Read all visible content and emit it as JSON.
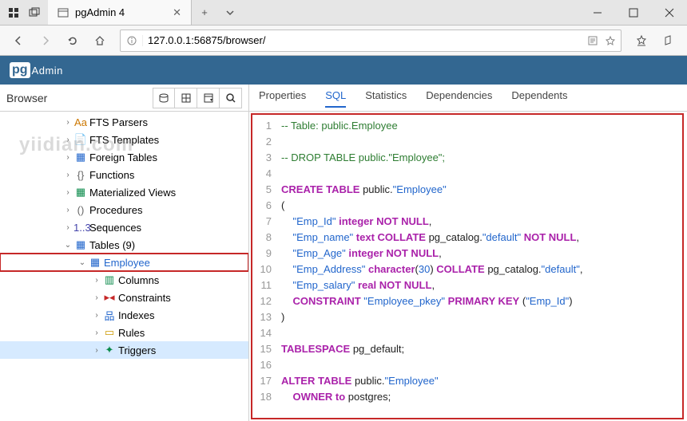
{
  "browser": {
    "tab_title": "pgAdmin 4",
    "url": "127.0.0.1:56875/browser/",
    "new_tab": "+"
  },
  "pg": {
    "logo_left": "pg",
    "logo_right": "Admin"
  },
  "sidebar": {
    "title": "Browser",
    "watermark": "yiidian.com",
    "items": [
      {
        "label": "FTS Parsers",
        "icon": "Aa",
        "arrow": ">",
        "lvl": 1,
        "color": "#cc7700"
      },
      {
        "label": "FTS Templates",
        "icon": "📄",
        "arrow": ">",
        "lvl": 1,
        "color": "#2266cc"
      },
      {
        "label": "Foreign Tables",
        "icon": "▦",
        "arrow": ">",
        "lvl": 1,
        "color": "#2266cc"
      },
      {
        "label": "Functions",
        "icon": "{}",
        "arrow": ">",
        "lvl": 1,
        "color": "#666"
      },
      {
        "label": "Materialized Views",
        "icon": "▦",
        "arrow": ">",
        "lvl": 1,
        "color": "#0a8a4a"
      },
      {
        "label": "Procedures",
        "icon": "()",
        "arrow": ">",
        "lvl": 1,
        "color": "#666"
      },
      {
        "label": "Sequences",
        "icon": "1..3",
        "arrow": ">",
        "lvl": 1,
        "color": "#4444aa"
      },
      {
        "label": "Tables (9)",
        "icon": "▦",
        "arrow": "v",
        "lvl": 1,
        "color": "#2266cc"
      },
      {
        "label": "Employee",
        "icon": "▦",
        "arrow": "v",
        "lvl": 2,
        "color": "#2266cc",
        "highlight": true
      },
      {
        "label": "Columns",
        "icon": "▥",
        "arrow": ">",
        "lvl": 3,
        "color": "#0a8a4a"
      },
      {
        "label": "Constraints",
        "icon": "▸◂",
        "arrow": ">",
        "lvl": 3,
        "color": "#c62828"
      },
      {
        "label": "Indexes",
        "icon": "品",
        "arrow": ">",
        "lvl": 3,
        "color": "#2266cc"
      },
      {
        "label": "Rules",
        "icon": "▭",
        "arrow": ">",
        "lvl": 3,
        "color": "#cc9900"
      },
      {
        "label": "Triggers",
        "icon": "✦",
        "arrow": ">",
        "lvl": 3,
        "color": "#0a8a4a",
        "selected": true
      }
    ]
  },
  "tabs": {
    "items": [
      {
        "label": "Properties",
        "name": "tab-properties"
      },
      {
        "label": "SQL",
        "name": "tab-sql",
        "active": true
      },
      {
        "label": "Statistics",
        "name": "tab-statistics"
      },
      {
        "label": "Dependencies",
        "name": "tab-dependencies"
      },
      {
        "label": "Dependents",
        "name": "tab-dependents"
      }
    ]
  },
  "code": {
    "lines": [
      [
        {
          "cls": "cmt",
          "t": "-- Table: public.Employee"
        }
      ],
      [],
      [
        {
          "cls": "cmt",
          "t": "-- DROP TABLE public.\"Employee\";"
        }
      ],
      [],
      [
        {
          "cls": "kw",
          "t": "CREATE TABLE"
        },
        {
          "cls": "txt",
          "t": " public."
        },
        {
          "cls": "str",
          "t": "\"Employee\""
        }
      ],
      [
        {
          "cls": "txt",
          "t": "("
        }
      ],
      [
        {
          "cls": "txt",
          "t": "    "
        },
        {
          "cls": "str",
          "t": "\"Emp_Id\""
        },
        {
          "cls": "txt",
          "t": " "
        },
        {
          "cls": "kw",
          "t": "integer"
        },
        {
          "cls": "txt",
          "t": " "
        },
        {
          "cls": "kw",
          "t": "NOT NULL"
        },
        {
          "cls": "txt",
          "t": ","
        }
      ],
      [
        {
          "cls": "txt",
          "t": "    "
        },
        {
          "cls": "str",
          "t": "\"Emp_name\""
        },
        {
          "cls": "txt",
          "t": " "
        },
        {
          "cls": "kw",
          "t": "text"
        },
        {
          "cls": "txt",
          "t": " "
        },
        {
          "cls": "kw",
          "t": "COLLATE"
        },
        {
          "cls": "txt",
          "t": " pg_catalog."
        },
        {
          "cls": "str",
          "t": "\"default\""
        },
        {
          "cls": "txt",
          "t": " "
        },
        {
          "cls": "kw",
          "t": "NOT NULL"
        },
        {
          "cls": "txt",
          "t": ","
        }
      ],
      [
        {
          "cls": "txt",
          "t": "    "
        },
        {
          "cls": "str",
          "t": "\"Emp_Age\""
        },
        {
          "cls": "txt",
          "t": " "
        },
        {
          "cls": "kw",
          "t": "integer"
        },
        {
          "cls": "txt",
          "t": " "
        },
        {
          "cls": "kw",
          "t": "NOT NULL"
        },
        {
          "cls": "txt",
          "t": ","
        }
      ],
      [
        {
          "cls": "txt",
          "t": "    "
        },
        {
          "cls": "str",
          "t": "\"Emp_Address\""
        },
        {
          "cls": "txt",
          "t": " "
        },
        {
          "cls": "kw",
          "t": "character"
        },
        {
          "cls": "txt",
          "t": "("
        },
        {
          "cls": "num",
          "t": "30"
        },
        {
          "cls": "txt",
          "t": ") "
        },
        {
          "cls": "kw",
          "t": "COLLATE"
        },
        {
          "cls": "txt",
          "t": " pg_catalog."
        },
        {
          "cls": "str",
          "t": "\"default\""
        },
        {
          "cls": "txt",
          "t": ","
        }
      ],
      [
        {
          "cls": "txt",
          "t": "    "
        },
        {
          "cls": "str",
          "t": "\"Emp_salary\""
        },
        {
          "cls": "txt",
          "t": " "
        },
        {
          "cls": "kw",
          "t": "real"
        },
        {
          "cls": "txt",
          "t": " "
        },
        {
          "cls": "kw",
          "t": "NOT NULL"
        },
        {
          "cls": "txt",
          "t": ","
        }
      ],
      [
        {
          "cls": "txt",
          "t": "    "
        },
        {
          "cls": "kw",
          "t": "CONSTRAINT"
        },
        {
          "cls": "txt",
          "t": " "
        },
        {
          "cls": "str",
          "t": "\"Employee_pkey\""
        },
        {
          "cls": "txt",
          "t": " "
        },
        {
          "cls": "kw",
          "t": "PRIMARY KEY"
        },
        {
          "cls": "txt",
          "t": " ("
        },
        {
          "cls": "str",
          "t": "\"Emp_Id\""
        },
        {
          "cls": "txt",
          "t": ")"
        }
      ],
      [
        {
          "cls": "txt",
          "t": ")"
        }
      ],
      [],
      [
        {
          "cls": "kw",
          "t": "TABLESPACE"
        },
        {
          "cls": "txt",
          "t": " pg_default;"
        }
      ],
      [],
      [
        {
          "cls": "kw",
          "t": "ALTER TABLE"
        },
        {
          "cls": "txt",
          "t": " public."
        },
        {
          "cls": "str",
          "t": "\"Employee\""
        }
      ],
      [
        {
          "cls": "txt",
          "t": "    "
        },
        {
          "cls": "kw",
          "t": "OWNER to"
        },
        {
          "cls": "txt",
          "t": " postgres;"
        }
      ]
    ]
  }
}
